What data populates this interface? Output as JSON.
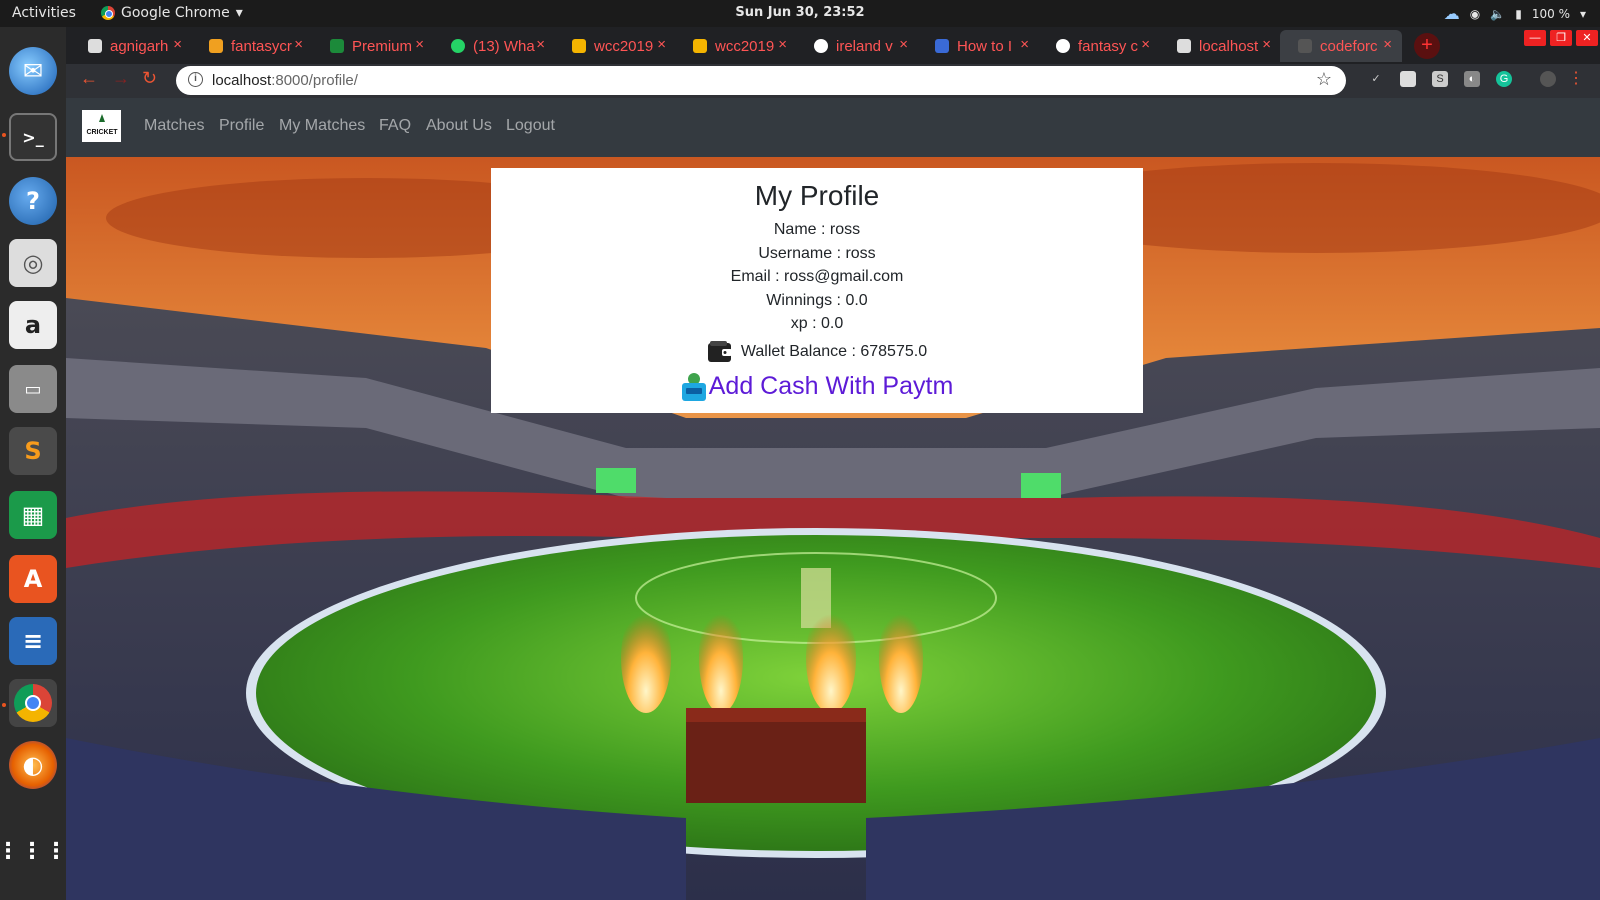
{
  "topbar": {
    "activities": "Activities",
    "app_menu": "Google Chrome",
    "clock": "Sun Jun 30, 23:52",
    "battery": "100 %"
  },
  "tabs": [
    {
      "label": "agnigarh",
      "favicon": "file-icon"
    },
    {
      "label": "fantasycr",
      "favicon": "flame-icon"
    },
    {
      "label": "Premium",
      "favicon": "shield-icon"
    },
    {
      "label": "(13) Wha",
      "favicon": "whatsapp-icon"
    },
    {
      "label": "wcc2019",
      "favicon": "drive-icon"
    },
    {
      "label": "wcc2019",
      "favicon": "drive-icon"
    },
    {
      "label": "ireland v",
      "favicon": "google-icon"
    },
    {
      "label": "How to I",
      "favicon": "grid-icon"
    },
    {
      "label": "fantasy c",
      "favicon": "google-icon"
    },
    {
      "label": "localhost",
      "favicon": "file-icon"
    },
    {
      "label": "codeforc",
      "favicon": "github-icon"
    }
  ],
  "omnibox": {
    "host": "localhost",
    "rest": ":8000/profile/"
  },
  "navbar": {
    "links": [
      "Matches",
      "Profile",
      "My Matches",
      "FAQ",
      "About Us",
      "Logout"
    ],
    "logo_text": "CRICKET"
  },
  "profile": {
    "title": "My Profile",
    "name": "Name : ross",
    "username": "Username : ross",
    "email": "Email : ross@gmail.com",
    "winnings": "Winnings : 0.0",
    "xp": "xp : 0.0",
    "wallet": "Wallet Balance : 678575.0",
    "add_cash": "Add Cash With Paytm"
  },
  "colors": {
    "navbar": "#343a40",
    "paytm_link": "#5d1bd7",
    "tab_text": "#ff5555"
  }
}
